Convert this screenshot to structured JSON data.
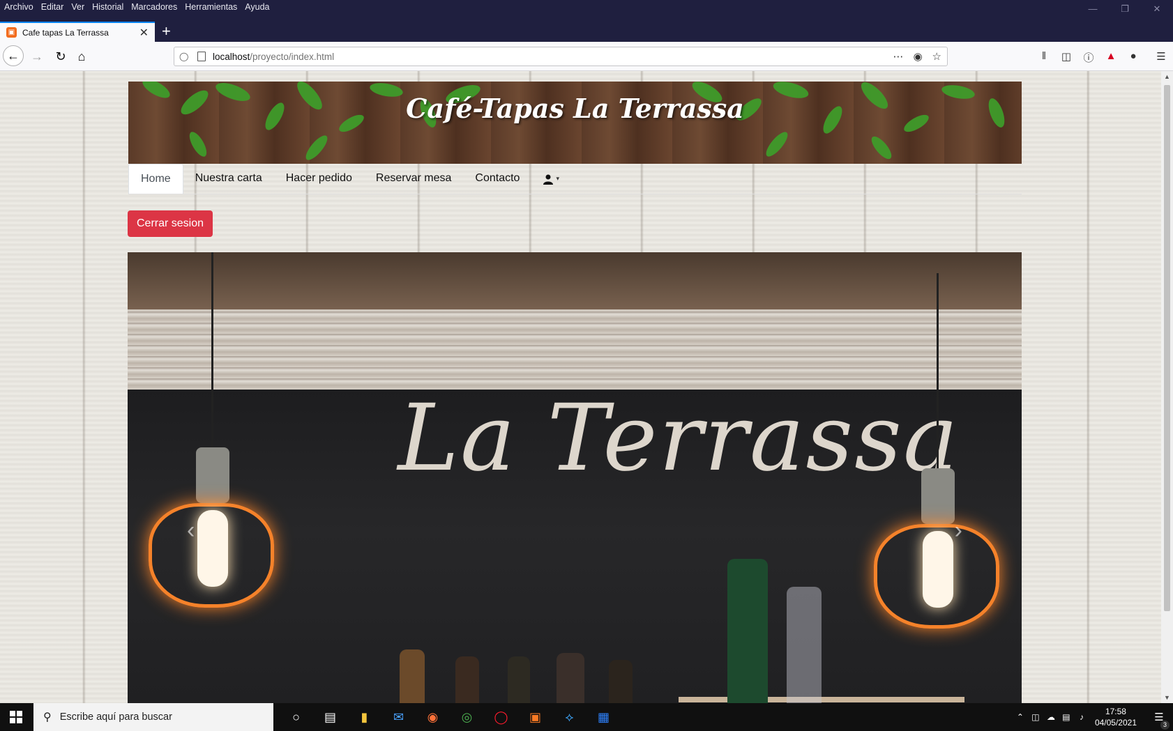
{
  "browser": {
    "menu": [
      "Archivo",
      "Editar",
      "Ver",
      "Historial",
      "Marcadores",
      "Herramientas",
      "Ayuda"
    ],
    "tab": {
      "title": "Cafe tapas La Terrassa"
    },
    "url": {
      "host": "localhost",
      "path": "/proyecto/index.html"
    }
  },
  "site": {
    "title": "Café-Tapas La Terrassa",
    "nav": [
      "Home",
      "Nuestra carta",
      "Hacer pedido",
      "Reservar mesa",
      "Contacto"
    ],
    "active_nav": "Home",
    "logout_label": "Cerrar sesion",
    "hero_text": "La Terrassa",
    "carousel_prev": "‹",
    "carousel_next": "›",
    "colors": {
      "logout": "#dc3545",
      "lamp": "#f5822a"
    }
  },
  "taskbar": {
    "search_placeholder": "Escribe aquí para buscar",
    "time": "17:58",
    "date": "04/05/2021",
    "notifications": "3"
  }
}
